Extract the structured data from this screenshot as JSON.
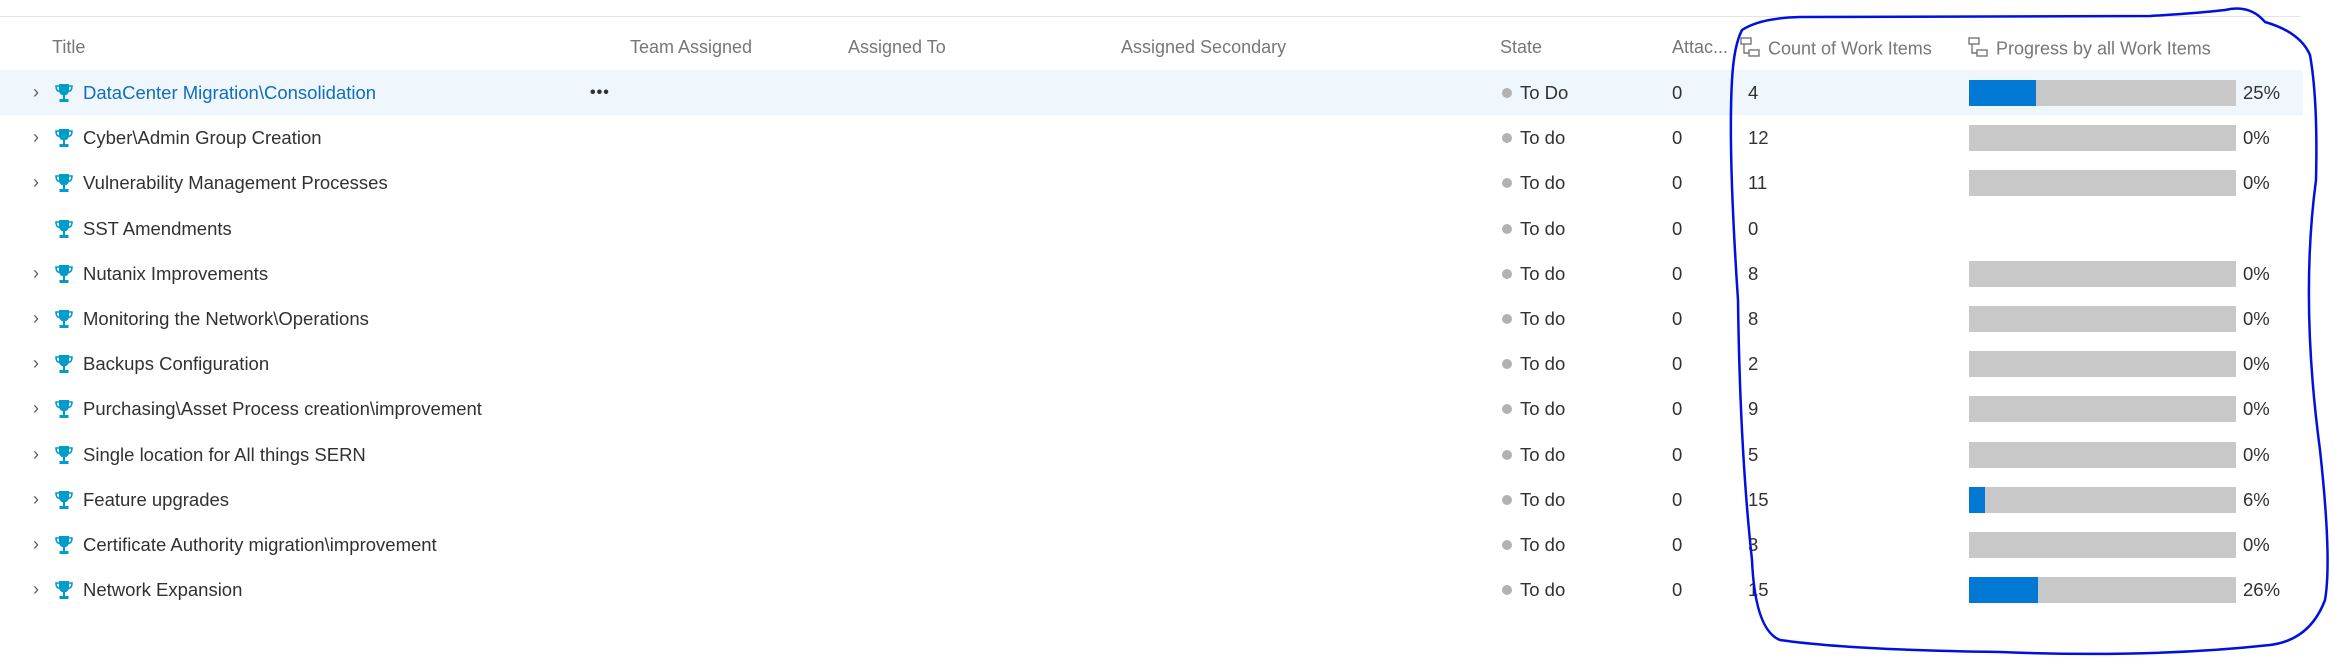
{
  "columns": {
    "title": "Title",
    "team": "Team Assigned",
    "assigned_to": "Assigned To",
    "assigned_secondary": "Assigned Secondary",
    "state": "State",
    "attachments": "Attac...",
    "count": "Count of Work Items",
    "progress": "Progress by all Work Items"
  },
  "colors": {
    "accent": "#0078d4",
    "bar_bg": "#c8c8c8",
    "selected_row": "#eff6fc",
    "trophy": "#009ccc",
    "annotation": "#0010e0"
  },
  "more_label": "•••",
  "rows": [
    {
      "title": "DataCenter Migration\\Consolidation",
      "state": "To Do",
      "attachments": "0",
      "count": "4",
      "progress": 25,
      "progress_label": "25%",
      "expandable": true
    },
    {
      "title": "Cyber\\Admin Group Creation",
      "state": "To do",
      "attachments": "0",
      "count": "12",
      "progress": 0,
      "progress_label": "0%",
      "expandable": true
    },
    {
      "title": "Vulnerability Management Processes",
      "state": "To do",
      "attachments": "0",
      "count": "11",
      "progress": 0,
      "progress_label": "0%",
      "expandable": true
    },
    {
      "title": "SST Amendments",
      "state": "To do",
      "attachments": "0",
      "count": "0",
      "progress": null,
      "progress_label": null,
      "expandable": false
    },
    {
      "title": "Nutanix Improvements",
      "state": "To do",
      "attachments": "0",
      "count": "8",
      "progress": 0,
      "progress_label": "0%",
      "expandable": true
    },
    {
      "title": "Monitoring the Network\\Operations",
      "state": "To do",
      "attachments": "0",
      "count": "8",
      "progress": 0,
      "progress_label": "0%",
      "expandable": true
    },
    {
      "title": "Backups Configuration",
      "state": "To do",
      "attachments": "0",
      "count": "2",
      "progress": 0,
      "progress_label": "0%",
      "expandable": true
    },
    {
      "title": "Purchasing\\Asset Process creation\\improvement",
      "state": "To do",
      "attachments": "0",
      "count": "9",
      "progress": 0,
      "progress_label": "0%",
      "expandable": true
    },
    {
      "title": "Single location for All things SERN",
      "state": "To do",
      "attachments": "0",
      "count": "5",
      "progress": 0,
      "progress_label": "0%",
      "expandable": true
    },
    {
      "title": "Feature upgrades",
      "state": "To do",
      "attachments": "0",
      "count": "15",
      "progress": 6,
      "progress_label": "6%",
      "expandable": true
    },
    {
      "title": "Certificate Authority migration\\improvement",
      "state": "To do",
      "attachments": "0",
      "count": "3",
      "progress": 0,
      "progress_label": "0%",
      "expandable": true
    },
    {
      "title": "Network Expansion",
      "state": "To do",
      "attachments": "0",
      "count": "15",
      "progress": 26,
      "progress_label": "26%",
      "expandable": true
    }
  ]
}
